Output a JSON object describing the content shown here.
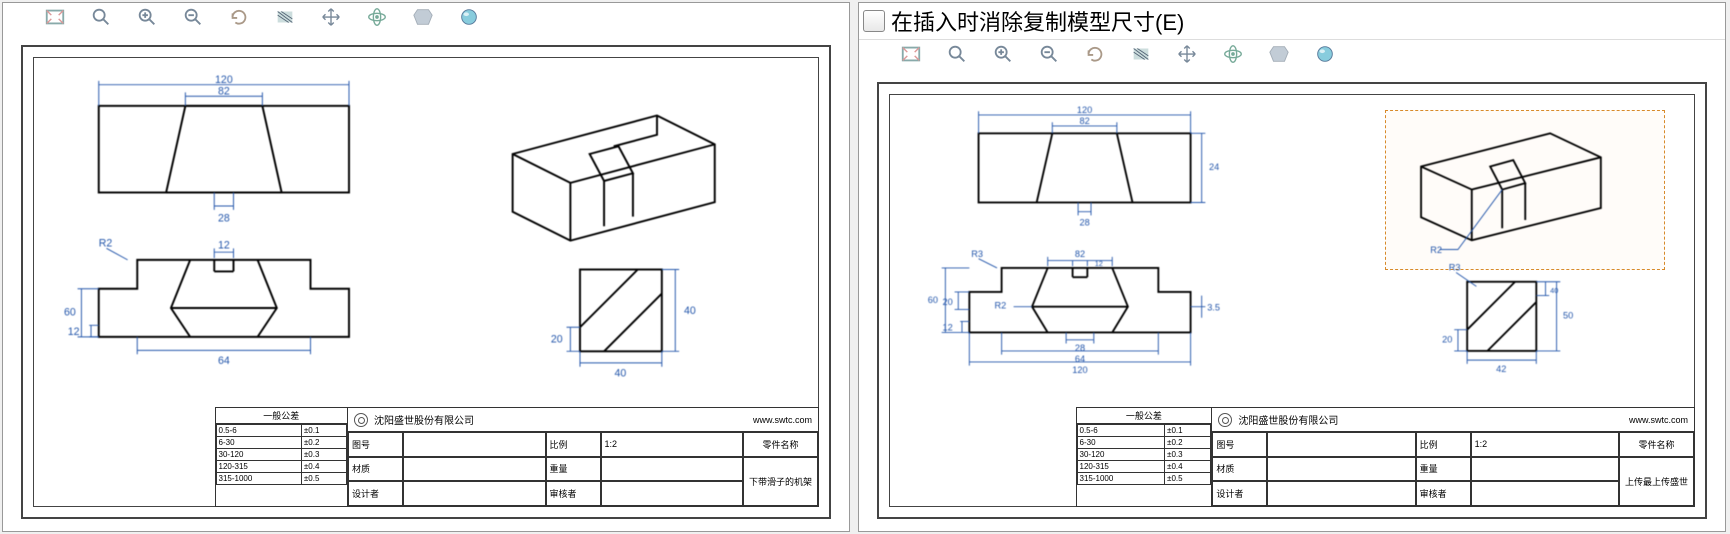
{
  "icons": [
    "zoom-fit",
    "zoom-window",
    "zoom-in",
    "zoom-out",
    "rotate",
    "section",
    "pan",
    "orbit",
    "view",
    "appearance"
  ],
  "option": {
    "label": "在插入时消除复制模型尺寸(E)",
    "checked": false
  },
  "drawing_left": {
    "dims_top": {
      "overall": "120",
      "inner": "82"
    },
    "dims_top_below": "28",
    "dims_front": {
      "height": "60",
      "sub": "12",
      "bottom": "64",
      "lead": "R2",
      "inner": "12"
    },
    "dims_side": {
      "h": "40",
      "w": "40",
      "sub": "20"
    },
    "title_block": {
      "company": "沈阳盛世股份有限公司",
      "url": "www.swtc.com",
      "tol_header": "一般公差",
      "tol_rows": [
        [
          "0.5-6",
          "±0.1"
        ],
        [
          "6-30",
          "±0.2"
        ],
        [
          "30-120",
          "±0.3"
        ],
        [
          "120-315",
          "±0.4"
        ],
        [
          "315-1000",
          "±0.5"
        ]
      ],
      "fields": {
        "l1": "图号",
        "v1": "",
        "l2": "比例",
        "v2": "1:2",
        "l3": "材质",
        "v3": "",
        "l4": "重量",
        "v4": "",
        "l5": "设计者",
        "v5": "",
        "l6": "审核者",
        "v6": "",
        "partname_label": "零件名称",
        "partname": "下带滑子的机架"
      }
    }
  },
  "drawing_right": {
    "dims_top": {
      "overall": "120",
      "inner": "82"
    },
    "dims_top_below": "28",
    "dims_top_right": "24",
    "dims_front": {
      "height": "60",
      "sub1": "20",
      "sub2": "12",
      "bottom_inner": "28",
      "bottom_mid": "64",
      "bottom_overall": "120",
      "lead_left": "R3",
      "right": "3.5",
      "lead": "R2",
      "inner": "82",
      "inner2": "12"
    },
    "dims_side": {
      "h": "50",
      "mid": "40",
      "sub": "20",
      "w": "42",
      "lead": "R3"
    },
    "iso_lead": "R2",
    "title_block": {
      "company": "沈阳盛世股份有限公司",
      "url": "www.swtc.com",
      "tol_header": "一般公差",
      "tol_rows": [
        [
          "0.5-6",
          "±0.1"
        ],
        [
          "6-30",
          "±0.2"
        ],
        [
          "30-120",
          "±0.3"
        ],
        [
          "120-315",
          "±0.4"
        ],
        [
          "315-1000",
          "±0.5"
        ]
      ],
      "fields": {
        "l1": "图号",
        "v1": "",
        "l2": "比例",
        "v2": "1:2",
        "l3": "材质",
        "v3": "",
        "l4": "重量",
        "v4": "",
        "l5": "设计者",
        "v5": "",
        "l6": "审核者",
        "v6": "",
        "partname_label": "零件名称",
        "partname": "上传最上传盛世"
      }
    }
  }
}
